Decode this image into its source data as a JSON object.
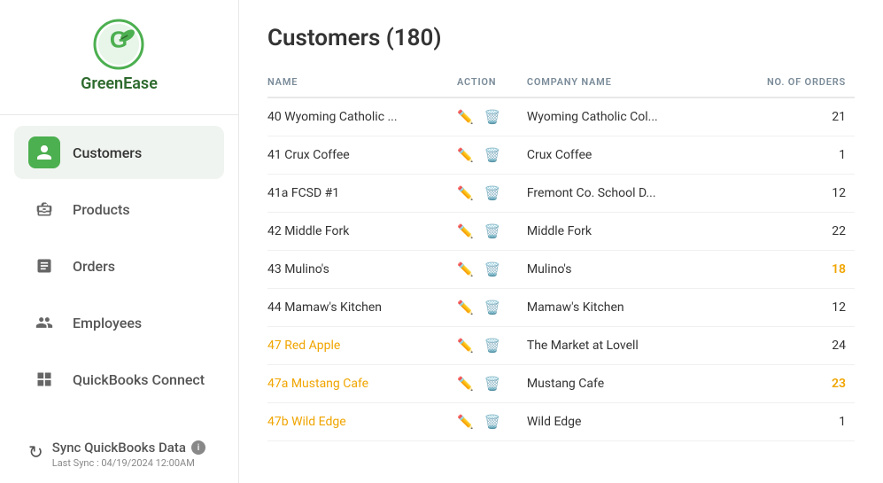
{
  "app": {
    "name": "GreenEase"
  },
  "sidebar": {
    "items": [
      {
        "id": "customers",
        "label": "Customers",
        "icon": "👤",
        "active": true
      },
      {
        "id": "products",
        "label": "Products",
        "icon": "📦",
        "active": false
      },
      {
        "id": "orders",
        "label": "Orders",
        "icon": "📋",
        "active": false
      },
      {
        "id": "employees",
        "label": "Employees",
        "icon": "👥",
        "active": false
      },
      {
        "id": "quickbooks-connect",
        "label": "QuickBooks Connect",
        "icon": "⊞",
        "active": false
      }
    ],
    "sync": {
      "label": "Sync QuickBooks Data",
      "last_sync": "Last Sync : 04/19/2024 12:00AM"
    }
  },
  "main": {
    "title": "Customers (180)",
    "table": {
      "columns": [
        "NAME",
        "ACTION",
        "COMPANY NAME",
        "NO. OF ORDERS"
      ],
      "rows": [
        {
          "name": "40 Wyoming Catholic ...",
          "company": "Wyoming Catholic Col...",
          "orders": "21",
          "highlighted_name": false,
          "highlighted_orders": false
        },
        {
          "name": "41 Crux Coffee",
          "company": "Crux Coffee",
          "orders": "1",
          "highlighted_name": false,
          "highlighted_orders": false
        },
        {
          "name": "41a FCSD #1",
          "company": "Fremont Co. School D...",
          "orders": "12",
          "highlighted_name": false,
          "highlighted_orders": false
        },
        {
          "name": "42 Middle Fork",
          "company": "Middle Fork",
          "orders": "22",
          "highlighted_name": false,
          "highlighted_orders": false
        },
        {
          "name": "43 Mulino's",
          "company": "Mulino's",
          "orders": "18",
          "highlighted_name": false,
          "highlighted_orders": true
        },
        {
          "name": "44 Mamaw's Kitchen",
          "company": "Mamaw's Kitchen",
          "orders": "12",
          "highlighted_name": false,
          "highlighted_orders": false
        },
        {
          "name": "47 Red Apple",
          "company": "The Market at Lovell",
          "orders": "24",
          "highlighted_name": true,
          "highlighted_orders": false
        },
        {
          "name": "47a Mustang Cafe",
          "company": "Mustang Cafe",
          "orders": "23",
          "highlighted_name": true,
          "highlighted_orders": true
        },
        {
          "name": "47b Wild Edge",
          "company": "Wild Edge",
          "orders": "1",
          "highlighted_name": true,
          "highlighted_orders": false
        }
      ]
    }
  }
}
